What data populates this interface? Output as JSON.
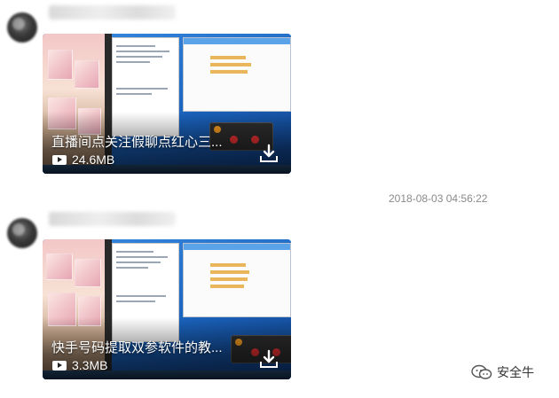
{
  "messages": [
    {
      "video": {
        "title": "直播间点关注假聊点红心三...",
        "size": "24.6MB"
      }
    },
    {
      "video": {
        "title": "快手号码提取双参软件的教...",
        "size": "3.3MB"
      }
    }
  ],
  "timestamp": "2018-08-03 04:56:22",
  "watermark": {
    "text": "安全牛",
    "icon": "wechat-logo-icon"
  },
  "icons": {
    "play": "play-icon",
    "download": "download-icon"
  },
  "colors": {
    "background": "#ffffff",
    "timestamp": "#8a8a8a",
    "overlay_text": "#ffffff"
  }
}
